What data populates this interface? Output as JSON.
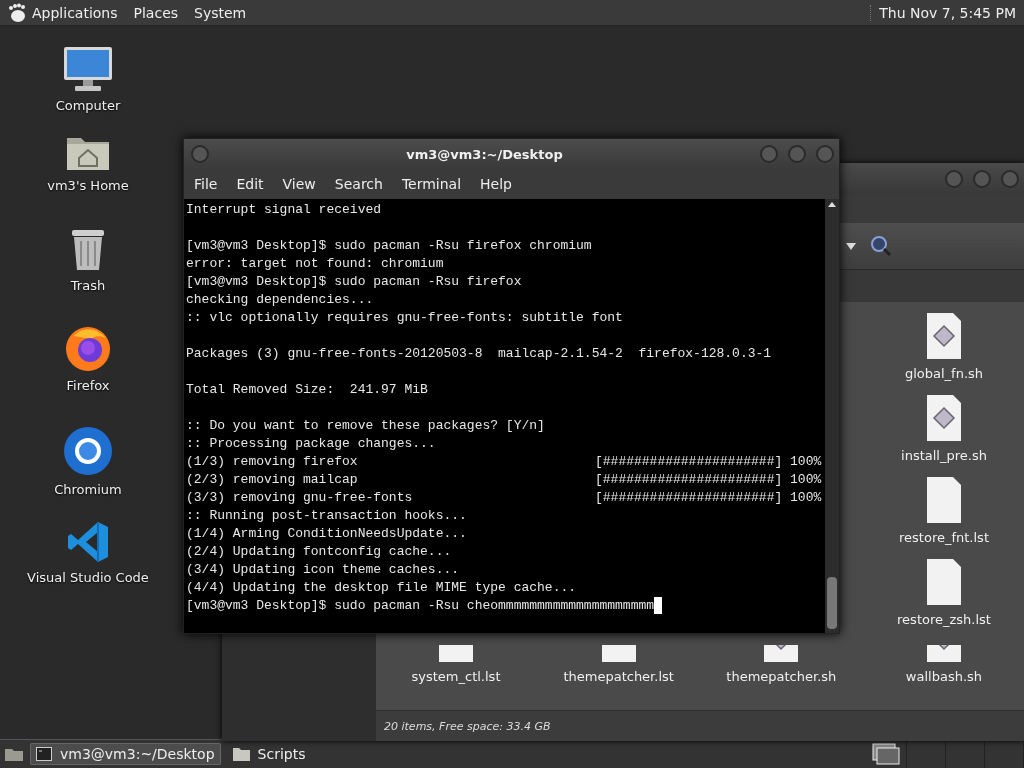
{
  "top_panel": {
    "menus": [
      "Applications",
      "Places",
      "System"
    ],
    "clock": "Thu Nov 7, 5:45 PM"
  },
  "desktop_icons": [
    {
      "label": "Computer",
      "kind": "computer"
    },
    {
      "label": "vm3's Home",
      "kind": "home"
    },
    {
      "label": "Trash",
      "kind": "trash"
    },
    {
      "label": "Firefox",
      "kind": "firefox"
    },
    {
      "label": "Chromium",
      "kind": "chromium"
    },
    {
      "label": "Visual Studio Code",
      "kind": "vscode"
    }
  ],
  "file_manager": {
    "files_right_column": [
      {
        "name": "global_fn.sh",
        "kind": "script"
      },
      {
        "name": "install_pre.sh",
        "kind": "script"
      },
      {
        "name": "restore_fnt.lst",
        "kind": "text"
      },
      {
        "name": "restore_zsh.lst",
        "kind": "text"
      }
    ],
    "files_bottom_row": [
      {
        "name": "system_ctl.lst",
        "kind": "text"
      },
      {
        "name": "themepatcher.lst",
        "kind": "text"
      },
      {
        "name": "themepatcher.sh",
        "kind": "script"
      },
      {
        "name": "wallbash.sh",
        "kind": "script"
      }
    ],
    "status": "20 items, Free space: 33.4 GB"
  },
  "terminal": {
    "title": "vm3@vm3:~/Desktop",
    "menu": [
      "File",
      "Edit",
      "View",
      "Search",
      "Terminal",
      "Help"
    ],
    "blocks": [
      [
        {
          "kind": "text",
          "text": "Interrupt signal received"
        }
      ],
      [
        {
          "kind": "text",
          "text": "[vm3@vm3 Desktop]$ sudo pacman -Rsu firefox chromium"
        },
        {
          "kind": "text",
          "text": "error: target not found: chromium"
        },
        {
          "kind": "text",
          "text": "[vm3@vm3 Desktop]$ sudo pacman -Rsu firefox"
        },
        {
          "kind": "text",
          "text": "checking dependencies..."
        },
        {
          "kind": "text",
          "text": ":: vlc optionally requires gnu-free-fonts: subtitle font"
        }
      ],
      [
        {
          "kind": "text",
          "text": "Packages (3) gnu-free-fonts-20120503-8  mailcap-2.1.54-2  firefox-128.0.3-1"
        }
      ],
      [
        {
          "kind": "text",
          "text": "Total Removed Size:  241.97 MiB"
        }
      ],
      [
        {
          "kind": "text",
          "text": ":: Do you want to remove these packages? [Y/n]"
        },
        {
          "kind": "text",
          "text": ":: Processing package changes..."
        },
        {
          "kind": "progress",
          "text": "(1/3) removing firefox",
          "bar": "[######################]",
          "percent": "100%"
        },
        {
          "kind": "progress",
          "text": "(2/3) removing mailcap",
          "bar": "[######################]",
          "percent": "100%"
        },
        {
          "kind": "progress",
          "text": "(3/3) removing gnu-free-fonts",
          "bar": "[######################]",
          "percent": "100%"
        },
        {
          "kind": "text",
          "text": ":: Running post-transaction hooks..."
        },
        {
          "kind": "text",
          "text": "(1/4) Arming ConditionNeedsUpdate..."
        },
        {
          "kind": "text",
          "text": "(2/4) Updating fontconfig cache..."
        },
        {
          "kind": "text",
          "text": "(3/4) Updating icon theme caches..."
        },
        {
          "kind": "text",
          "text": "(4/4) Updating the desktop file MIME type cache..."
        },
        {
          "kind": "prompt",
          "text": "[vm3@vm3 Desktop]$ sudo pacman -Rsu cheommmmmmmmmmmmmmmmmmmm"
        }
      ]
    ]
  },
  "taskbar": {
    "tasks": [
      {
        "label": "vm3@vm3:~/Desktop",
        "kind": "terminal",
        "selected": true
      },
      {
        "label": "Scripts",
        "kind": "folder",
        "selected": false
      }
    ]
  }
}
